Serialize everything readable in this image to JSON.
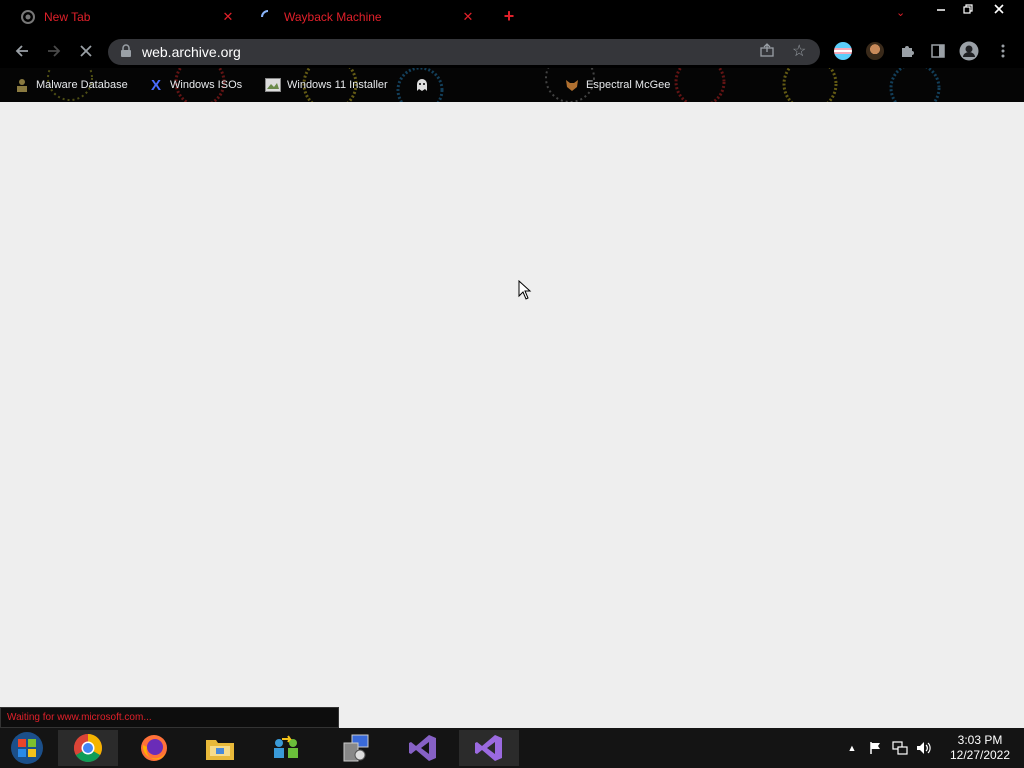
{
  "tabs": [
    {
      "title": "New Tab",
      "icon": "chrome-icon"
    },
    {
      "title": "Wayback Machine",
      "icon": "loading-spinner-icon"
    }
  ],
  "new_tab_symbol": "+",
  "toolbar": {
    "url": "web.archive.org"
  },
  "bookmarks": [
    {
      "label": "Malware Database",
      "icon": "person-icon"
    },
    {
      "label": "Windows ISOs",
      "icon": "x-logo-icon"
    },
    {
      "label": "Windows 11 Installer",
      "icon": "image-icon"
    },
    {
      "label": "",
      "icon": "ghost-icon"
    },
    {
      "label": "Espectral McGee",
      "icon": "fox-icon"
    }
  ],
  "status_text": "Waiting for www.microsoft.com...",
  "taskbar": {
    "apps": [
      "start-orb",
      "chrome",
      "firefox",
      "file-explorer",
      "windows-easy-transfer",
      "installer",
      "visual-studio",
      "visual-studio-alt"
    ],
    "clock_time": "3:03 PM",
    "clock_date": "12/27/2022"
  },
  "colors": {
    "accent": "#e0202a",
    "page_bg": "#eeeeee",
    "chrome_bg": "#000000",
    "omnibox_bg": "#35363a"
  }
}
